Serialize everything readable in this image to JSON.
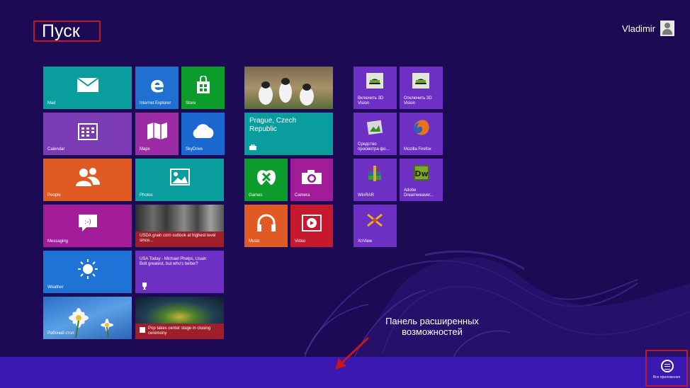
{
  "header": {
    "title": "Пуск",
    "user_name": "Vladimir"
  },
  "group1": {
    "mail": "Mail",
    "ie": "Internet Explorer",
    "store": "Store",
    "calendar": "Calendar",
    "maps": "Maps",
    "skydrive": "SkyDrive",
    "people": "People",
    "photos": "Photos",
    "messaging": "Messaging",
    "news_headline": "USDA grain corn outlook at highest level since...",
    "weather": "Weather",
    "sports_headline": "USA Today - Michael Phelps, Usain Bolt greatest, but who's better?",
    "desktop": "Рабочий стол",
    "news2_headline": "Pop takes center stage in closing ceremony"
  },
  "group2": {
    "travel_city": "Prague, Czech Republic",
    "games": "Games",
    "camera": "Camera",
    "music": "Music",
    "video": "Video"
  },
  "group3": {
    "vision_on": "Включить 3D Vision",
    "vision_off": "Отключить 3D Vision",
    "viewer": "Средство просмотра фо...",
    "firefox": "Mozilla Firefox",
    "winrar": "WinRAR",
    "dreamweaver": "Adobe Dreamweaver...",
    "xnview": "XnView"
  },
  "annotation": {
    "line1": "Панель расширенных",
    "line2": "возможностей"
  },
  "appbar": {
    "all_apps": "Все приложения"
  },
  "colors": {
    "background": "#1d0a55",
    "appbar": "#3a19b2",
    "highlight": "#c5161f"
  }
}
